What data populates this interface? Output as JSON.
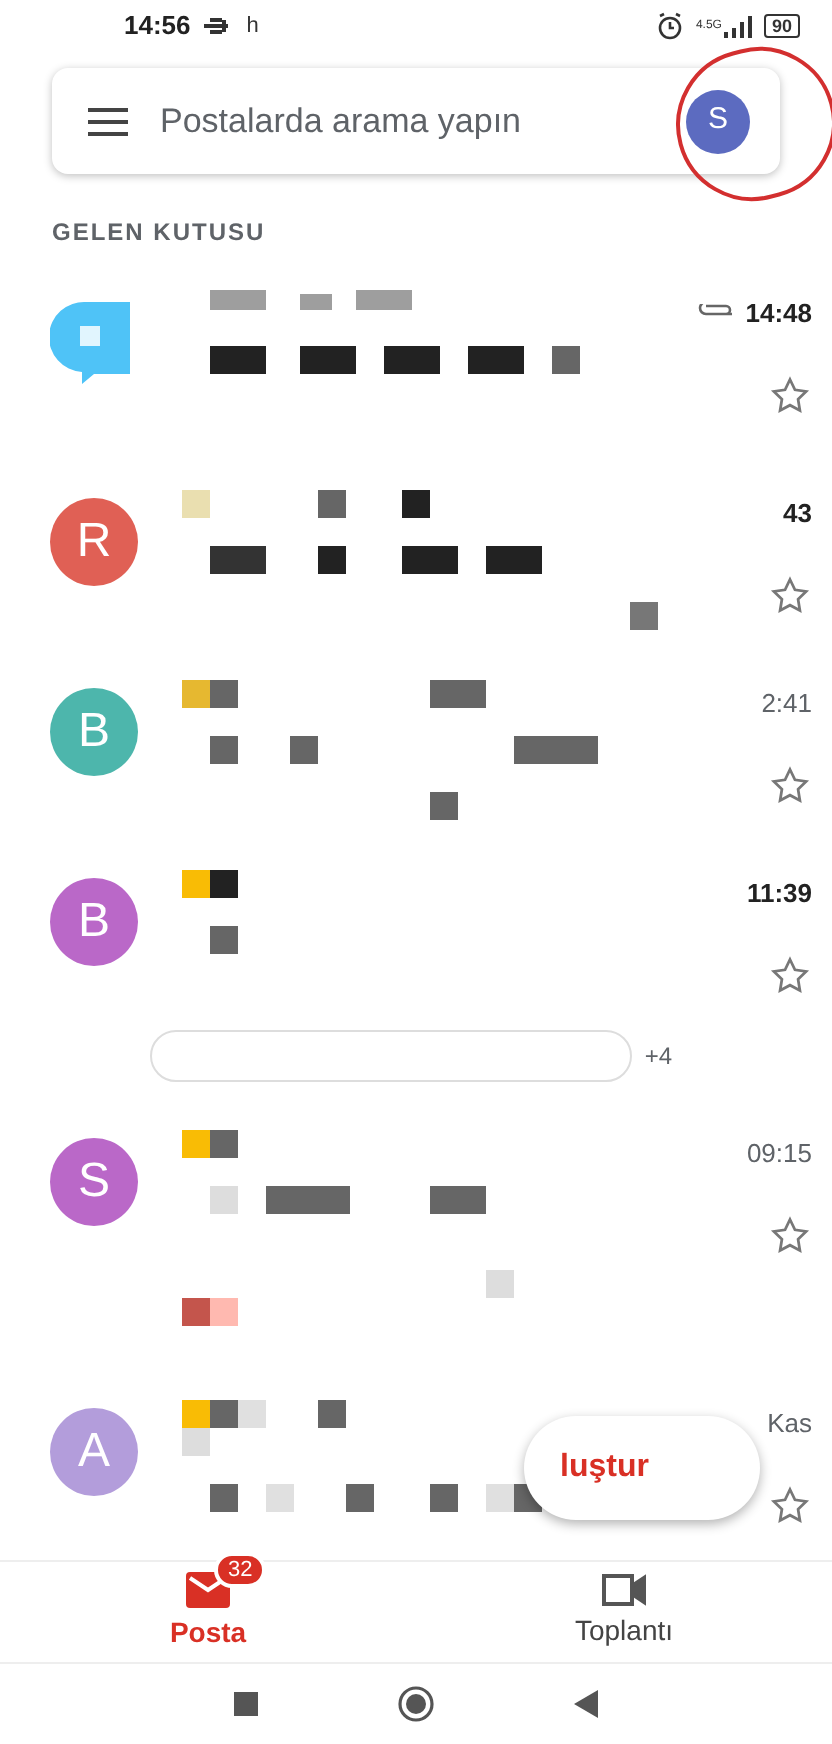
{
  "status_bar": {
    "time": "14:56",
    "extra": "h",
    "network": "4.5G",
    "battery": "90"
  },
  "search": {
    "placeholder": "Postalarda arama yapın",
    "avatar": "S",
    "annotated": true
  },
  "section_title": "GELEN KUTUSU",
  "emails": [
    {
      "kind": "logo",
      "color": "#4fc3f7",
      "time": "14:48",
      "unread": true,
      "attachment": true,
      "starred": false
    },
    {
      "kind": "letter",
      "avatar": "R",
      "color": "#e06055",
      "time": "43",
      "unread": true,
      "attachment": false,
      "starred": false
    },
    {
      "kind": "letter",
      "avatar": "B",
      "color": "#4db6ac",
      "time": "2:41",
      "unread": false,
      "attachment": false,
      "starred": false
    },
    {
      "kind": "letter",
      "avatar": "B",
      "color": "#ba68c8",
      "time": "11:39",
      "unread": true,
      "attachment": false,
      "starred": false,
      "extra_chip": "+4"
    },
    {
      "kind": "letter",
      "avatar": "S",
      "color": "#ba68c8",
      "time": "09:15",
      "unread": false,
      "attachment": false,
      "starred": false
    },
    {
      "kind": "letter",
      "avatar": "A",
      "color": "#b39ddb",
      "time": "Kas",
      "unread": false,
      "attachment": false,
      "starred": false
    }
  ],
  "compose": {
    "label": "luştur"
  },
  "bottom_nav": [
    {
      "kind": "mail",
      "label": "Posta",
      "badge": "32",
      "selected": true
    },
    {
      "kind": "video",
      "label": "Toplantı",
      "selected": false
    }
  ]
}
